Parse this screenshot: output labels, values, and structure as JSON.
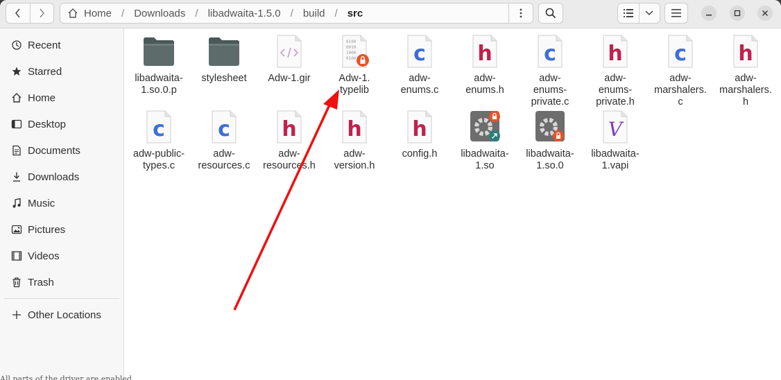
{
  "headerbar": {
    "path": [
      "Home",
      "Downloads",
      "libadwaita-1.5.0",
      "build",
      "src"
    ],
    "icons": {
      "back": "chevron-left-icon",
      "forward": "chevron-right-icon",
      "home": "home-icon",
      "path_menu": "vertical-dots-icon",
      "search": "search-icon",
      "list_view": "list-view-icon",
      "view_options": "chevron-down-icon",
      "main_menu": "hamburger-menu-icon",
      "minimize": "minimize-icon",
      "maximize": "maximize-icon",
      "close": "close-icon"
    }
  },
  "sidebar": {
    "items": [
      {
        "label": "Recent",
        "icon": "clock-icon"
      },
      {
        "label": "Starred",
        "icon": "star-icon"
      },
      {
        "label": "Home",
        "icon": "home-icon"
      },
      {
        "label": "Desktop",
        "icon": "desktop-icon"
      },
      {
        "label": "Documents",
        "icon": "document-icon"
      },
      {
        "label": "Downloads",
        "icon": "download-icon"
      },
      {
        "label": "Music",
        "icon": "music-icon"
      },
      {
        "label": "Pictures",
        "icon": "picture-icon"
      },
      {
        "label": "Videos",
        "icon": "video-icon"
      },
      {
        "label": "Trash",
        "icon": "trash-icon"
      }
    ],
    "other_locations": {
      "label": "Other Locations",
      "icon": "plus-icon"
    }
  },
  "files": [
    {
      "name": "libadwaita-1.so.0.p",
      "type": "folder"
    },
    {
      "name": "stylesheet",
      "type": "folder"
    },
    {
      "name": "Adw-1.gir",
      "type": "xml"
    },
    {
      "name": "Adw-1.typelib",
      "type": "binary-locked"
    },
    {
      "name": "adw-enums.c",
      "type": "c"
    },
    {
      "name": "adw-enums.h",
      "type": "h"
    },
    {
      "name": "adw-enums-private.c",
      "type": "c"
    },
    {
      "name": "adw-enums-private.h",
      "type": "h"
    },
    {
      "name": "adw-marshalers.c",
      "type": "c"
    },
    {
      "name": "adw-marshalers.h",
      "type": "h"
    },
    {
      "name": "adw-public-types.c",
      "type": "c"
    },
    {
      "name": "adw-resources.c",
      "type": "c"
    },
    {
      "name": "adw-resources.h",
      "type": "h"
    },
    {
      "name": "adw-version.h",
      "type": "h"
    },
    {
      "name": "config.h",
      "type": "h"
    },
    {
      "name": "libadwaita-1.so",
      "type": "lib-link"
    },
    {
      "name": "libadwaita-1.so.0",
      "type": "lib-locked"
    },
    {
      "name": "libadwaita-1.vapi",
      "type": "vapi"
    }
  ],
  "file_display_names": [
    "libadwaita-\n1.so.0.p",
    "stylesheet",
    "Adw-1.gir",
    "Adw-1.\ntypelib",
    "adw-\nenums.c",
    "adw-\nenums.h",
    "adw-\nenums-\nprivate.c",
    "adw-\nenums-\nprivate.h",
    "adw-\nmarshalers.\nc",
    "adw-\nmarshalers.\nh",
    "adw-public-\ntypes.c",
    "adw-\nresources.c",
    "adw-\nresources.h",
    "adw-\nversion.h",
    "config.h",
    "libadwaita-\n1.so",
    "libadwaita-\n1.so.0",
    "libadwaita-\n1.vapi"
  ],
  "colors": {
    "c_letter": "#3d6fd6",
    "h_letter": "#c0224d",
    "folder_dark": "#5d6b6b",
    "lock_badge": "#e8542a",
    "annotation_arrow": "#ee1111"
  },
  "bottom_text": "All parts of the driver are enabled"
}
